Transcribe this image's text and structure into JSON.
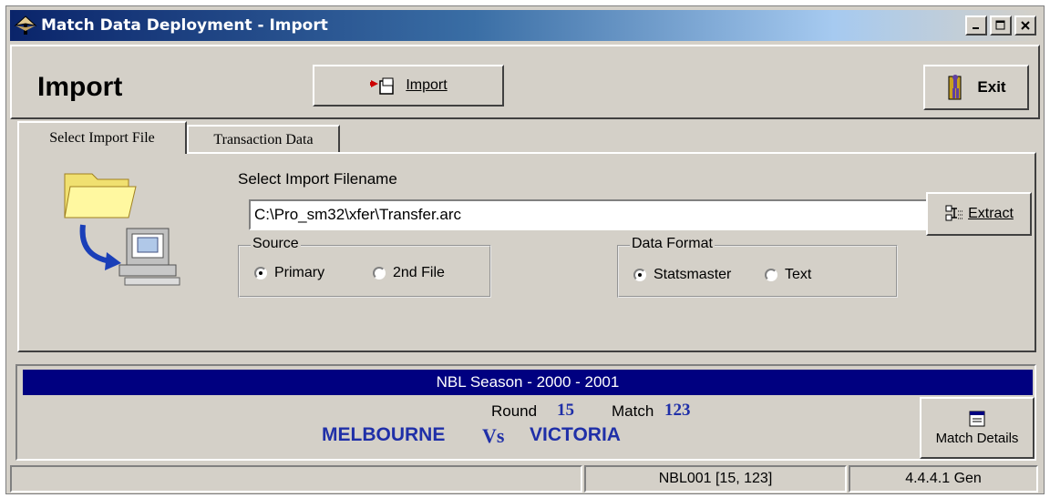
{
  "window": {
    "title": "Match Data Deployment - Import"
  },
  "toolbar": {
    "page_title": "Import",
    "import_label": "Import",
    "exit_label": "Exit"
  },
  "tabs": [
    {
      "label": "Select Import File",
      "active": true
    },
    {
      "label": "Transaction Data",
      "active": false
    }
  ],
  "import_file": {
    "filename_label": "Select Import Filename",
    "filename_value": "C:\\Pro_sm32\\xfer\\Transfer.arc",
    "extract_label": "Extract",
    "source": {
      "title": "Source",
      "options": [
        "Primary",
        "2nd File"
      ],
      "selected": "Primary"
    },
    "data_format": {
      "title": "Data Format",
      "options": [
        "Statsmaster",
        "Text"
      ],
      "selected": "Statsmaster"
    }
  },
  "match_info": {
    "season": "NBL Season - 2000 - 2001",
    "round_label": "Round",
    "round_value": "15",
    "match_label": "Match",
    "match_value": "123",
    "home_team": "MELBOURNE",
    "vs": "Vs",
    "away_team": "VICTORIA",
    "details_label": "Match Details"
  },
  "status": {
    "left": "",
    "middle": "NBL001 [15, 123]",
    "right": "4.4.4.1 Gen"
  },
  "colors": {
    "title_bar": "#0a246a",
    "season_bar": "#000080",
    "team_text": "#1f2fa8",
    "window_bg": "#d4d0c8"
  },
  "icons": [
    "app-icon",
    "import-icon",
    "exit-icon",
    "folder-icon",
    "arrow-icon",
    "computer-icon",
    "extract-icon",
    "match-details-icon"
  ]
}
